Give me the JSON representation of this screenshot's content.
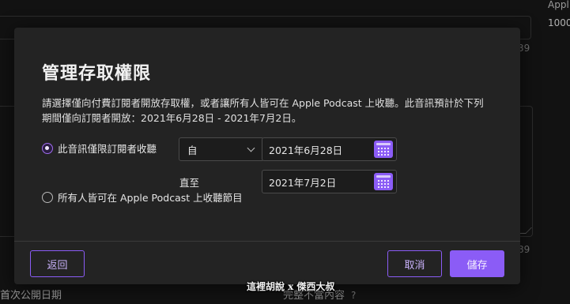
{
  "background": {
    "right_label": "Appl",
    "right_value": "1000",
    "count_top": "39",
    "count_bottom": "89",
    "bottom_left_text": "首次公開日期",
    "bottom_mid_text": "完整不當內容",
    "help_icon_glyph": "?"
  },
  "watermark": "這裡胡說 x 傑西大叔",
  "modal": {
    "title": "管理存取權限",
    "description": "請選擇僅向付費訂閱者開放存取權，或者讓所有人皆可在 Apple Podcast 上收聽。此音訊預計於下列期間僅向訂閱者開放：2021年6月28日 - 2021年7月2日。",
    "options": [
      {
        "label": "此音訊僅限訂閱者收聽",
        "selected": true
      },
      {
        "label": "所有人皆可在 Apple Podcast 上收聽節目",
        "selected": false
      }
    ],
    "from_select": {
      "value": "自"
    },
    "until_label": "直至",
    "start_date": "2021年6月28日",
    "end_date": "2021年7月2日",
    "buttons": {
      "back": "返回",
      "cancel": "取消",
      "save": "儲存"
    }
  },
  "colors": {
    "accent": "#8b5cf6",
    "modal_bg": "#232323",
    "page_bg": "#121212"
  },
  "icons": {
    "calendar": "calendar-icon",
    "chevron": "chevron-down-icon",
    "help": "help-icon"
  }
}
